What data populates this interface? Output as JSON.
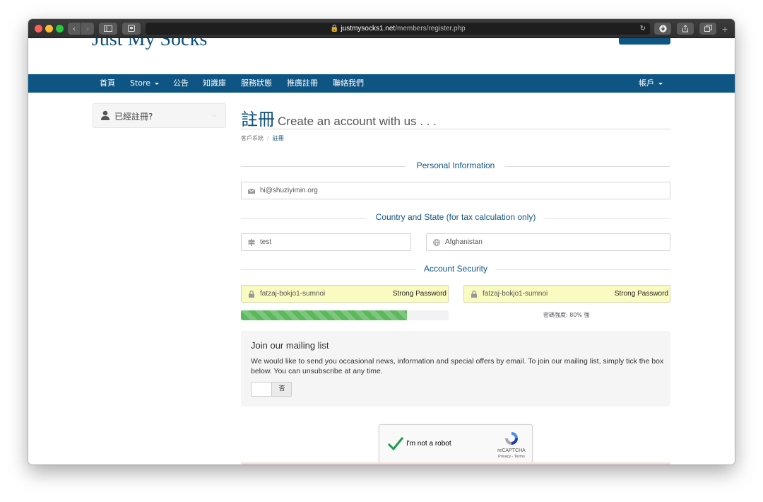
{
  "browser": {
    "url_domain": "justmysocks1.net",
    "url_path": "/members/register.php"
  },
  "site": {
    "logo": "Just My Socks"
  },
  "nav": {
    "items": [
      "首頁",
      "Store",
      "公告",
      "知識庫",
      "服務狀態",
      "推廣註冊",
      "聯絡我們"
    ],
    "account": "帳戶"
  },
  "sidebar": {
    "already_registered": "已經註冊?"
  },
  "main": {
    "title": "註冊",
    "subtitle": "Create an account with us . . .",
    "breadcrumb": [
      "客戶系統",
      "註冊"
    ],
    "sections": {
      "personal": "Personal Information",
      "country": "Country and State (for tax calculation only)",
      "security": "Account Security"
    },
    "email_value": "hi@shuziyimin.org",
    "state_value": "test",
    "country_value": "Afghanistan",
    "password_value": "fatzaj-bokjo1-sumnoi",
    "confirm_password_value": "fatzaj-bokjo1-sumnoi",
    "password_hint": "Strong Password",
    "confirm_password_hint": "Strong Password",
    "strength_percent": 80,
    "strength_label": "密碼強度: 80% 強"
  },
  "mailing": {
    "heading": "Join our mailing list",
    "description": "We would like to send you occasional news, information and special offers by email. To join our mailing list, simply tick the box below. You can unsubscribe at any time.",
    "toggle_label": "否"
  },
  "recaptcha": {
    "label": "I'm not a robot",
    "brand": "reCAPTCHA",
    "terms": "Privacy - Terms"
  },
  "colors": {
    "brand_blue": "#0f5584",
    "autofill_yellow": "#fafbc1",
    "progress_green": "#5cb85c"
  }
}
